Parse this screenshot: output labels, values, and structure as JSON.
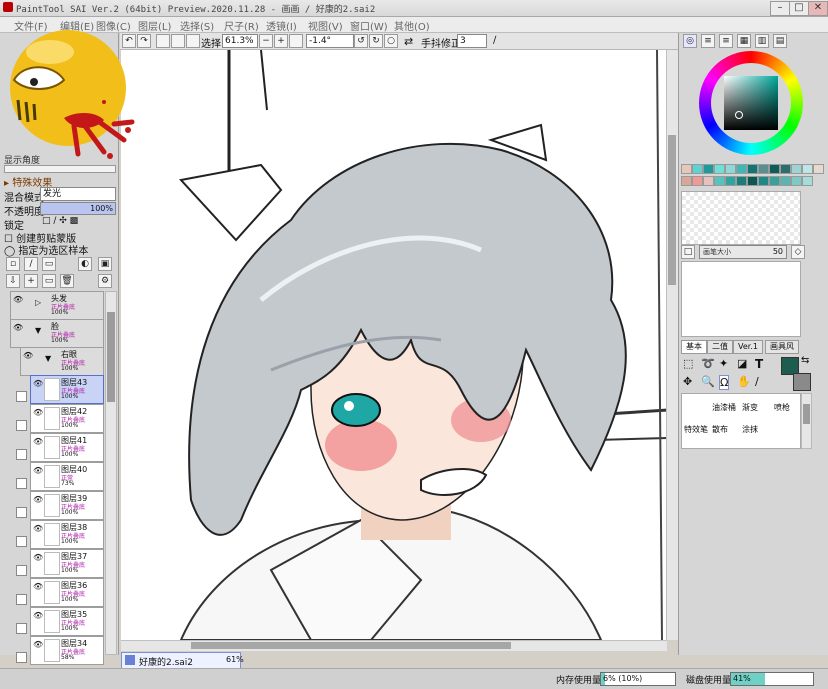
{
  "window": {
    "title": "PaintTool SAI Ver.2 (64bit) Preview.2020.11.28 - 画画 / 好康的2.sai2",
    "controls": [
      "–",
      "□",
      "✕"
    ]
  },
  "menubar": {
    "items": [
      "文件(F)",
      "编辑(E)",
      "图像(C)",
      "图层(L)",
      "选择(S)",
      "尺子(R)",
      "透镜(I)",
      "视图(V)",
      "窗口(W)",
      "其他(O)"
    ]
  },
  "toolbar": {
    "selection_label": "选择",
    "zoom_value": "61.3%",
    "angle_value": "-1.4°",
    "stabilizer_label": "手抖修正",
    "stabilizer_value": "3"
  },
  "left_panel": {
    "display_opacity_label": "显示角度",
    "effects_label": "特殊效果",
    "blend_label": "混合模式",
    "blend_value": "发光",
    "opacity_label": "不透明度",
    "opacity_value": "100%",
    "opacity_fraction": 1.0,
    "lock_label": "锁定",
    "clip_label": "创建剪贴蒙版",
    "sample_label": "指定为选区样本",
    "folders": [
      {
        "name": "头发",
        "mode": "正片叠底",
        "opacity": "100%"
      },
      {
        "name": "脸",
        "mode": "正片叠底",
        "opacity": "100%"
      },
      {
        "name": "右眼",
        "mode": "正片叠底",
        "opacity": "100%"
      }
    ],
    "layers": [
      {
        "name": "图层43",
        "mode": "正片叠底",
        "opacity": "100%"
      },
      {
        "name": "图层42",
        "mode": "正片叠底",
        "opacity": "100%"
      },
      {
        "name": "图层41",
        "mode": "正片叠底",
        "opacity": "100%"
      },
      {
        "name": "图层40",
        "mode": "正常",
        "opacity": "73%"
      },
      {
        "name": "图层39",
        "mode": "正片叠底",
        "opacity": "100%"
      },
      {
        "name": "图层38",
        "mode": "正片叠底",
        "opacity": "100%"
      },
      {
        "name": "图层37",
        "mode": "正片叠底",
        "opacity": "100%"
      },
      {
        "name": "图层36",
        "mode": "正片叠底",
        "opacity": "100%"
      },
      {
        "name": "图层35",
        "mode": "正片叠底",
        "opacity": "100%"
      },
      {
        "name": "图层34",
        "mode": "正片叠底",
        "opacity": "58%"
      }
    ]
  },
  "right_panel": {
    "brush_size_label": "画笔大小",
    "brush_size_value": "50",
    "tool_tabs": [
      "基本",
      "二值",
      "Ver.1",
      "画具风"
    ],
    "tools": [
      "油漆桶",
      "渐变",
      "喷枪",
      "特效笔",
      "散布",
      "涂抹"
    ],
    "swatches_row1": [
      "#e7c7b7",
      "#5fd3d3",
      "#1f9a9a",
      "#6fe0d8",
      "#8ed8d8",
      "#3fb7b7",
      "#137474",
      "#5a8f8f",
      "#0f5b5b",
      "#2c6d6d",
      "#9fd2d2",
      "#bfe6e6",
      "#e8d9cf"
    ],
    "swatches_row2": [
      "#d9a79a",
      "#f09a98",
      "#e5c1bf",
      "#56c3bf",
      "#2fa5a2",
      "#1a7e7b",
      "#0c5654",
      "#1e8986",
      "#3aa09c",
      "#5ab5b1",
      "#7fc9c5",
      "#a5dbd8"
    ]
  },
  "canvas": {
    "bg": "#ffffff"
  },
  "document_tab": {
    "name": "好康的2.sai2",
    "zoom": "61%"
  },
  "status": {
    "memory_label": "内存使用量",
    "memory_value": "6% (10%)",
    "memory_fraction": 0.06,
    "disk_label": "磁盘使用量",
    "disk_value": "41%",
    "disk_fraction": 0.41
  },
  "colors": {
    "accent": "#5a6fc8",
    "hair": "#b9bec4",
    "eye": "#1fa7a6",
    "blush": "#e85a6a",
    "emoji": "#f2bf1a"
  }
}
